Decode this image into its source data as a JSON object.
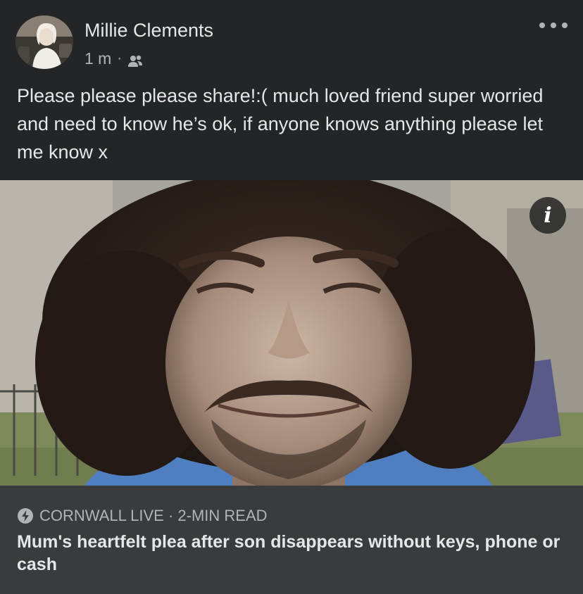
{
  "post": {
    "author": "Millie Clements",
    "time": "1 m",
    "separator": "·",
    "audience_icon": "friends-icon",
    "more_icon": "more-options-icon",
    "text": "Please please please share!:( much loved friend super worried and need to know he’s ok, if anyone knows anything please let me know x"
  },
  "photo": {
    "info_glyph": "i",
    "info_icon": "info-icon"
  },
  "link_preview": {
    "source_icon": "bolt-icon",
    "source": "CORNWALL LIVE · 2-MIN READ",
    "headline": "Mum's heartfelt plea after son disappears without keys, phone or cash"
  },
  "colors": {
    "background": "#242526",
    "preview_background": "#3a3b3c",
    "primary_text": "#e4e6eb",
    "secondary_text": "#b0b3b8"
  }
}
